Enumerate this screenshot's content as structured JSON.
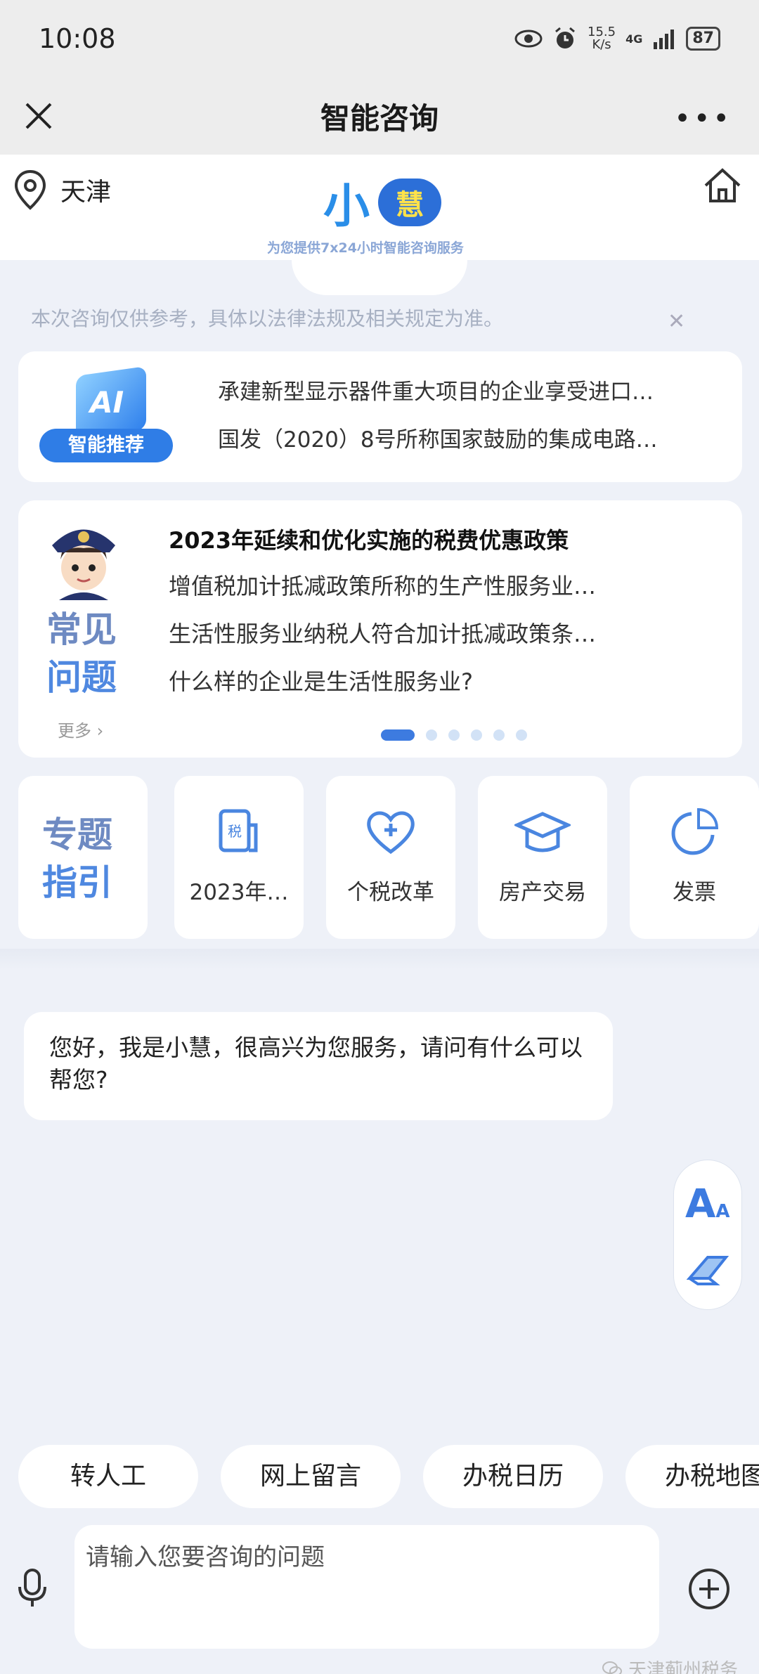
{
  "status": {
    "time": "10:08",
    "speed_top": "15.5",
    "speed_bottom": "K/s",
    "network": "4G",
    "battery": "87"
  },
  "nav": {
    "title": "智能咨询"
  },
  "header": {
    "city": "天津",
    "logo_left": "小",
    "logo_right": "慧",
    "slogan": "为您提供7x24小时智能咨询服务"
  },
  "notice": "本次咨询仅供参考，具体以法律法规及相关规定为准。",
  "recommend": {
    "badge": "智能推荐",
    "items": [
      "承建新型显示器件重大项目的企业享受进口…",
      "国发（2020）8号所称国家鼓励的集成电路…"
    ]
  },
  "faq": {
    "label_line1": "常见",
    "label_line2": "问题",
    "more": "更多 ›",
    "title": "2023年延续和优化实施的税费优惠政策",
    "items": [
      "增值税加计抵减政策所称的生产性服务业…",
      "生活性服务业纳税人符合加计抵减政策条…",
      "什么样的企业是生活性服务业?"
    ],
    "page_count": 6,
    "active_page": 1
  },
  "topics": {
    "guide_line1": "专题",
    "guide_line2": "指引",
    "items": [
      {
        "label": "2023年…",
        "icon": "tax-document-icon"
      },
      {
        "label": "个税改革",
        "icon": "heart-plus-icon"
      },
      {
        "label": "房产交易",
        "icon": "graduation-cap-icon"
      },
      {
        "label": "发票",
        "icon": "pie-chart-icon"
      }
    ]
  },
  "chat": {
    "greeting": "您好，我是小慧，很高兴为您服务，请问有什么可以帮您?"
  },
  "tools": {
    "font_size": "A",
    "font_size_small": "A"
  },
  "quick_actions": [
    "转人工",
    "网上留言",
    "办税日历",
    "办税地图"
  ],
  "input": {
    "placeholder": "请输入您要咨询的问题"
  },
  "watermark": "天津蓟州税务",
  "colors": {
    "accent": "#3d7be0",
    "card": "#ffffff",
    "background": "#eef1f8"
  }
}
